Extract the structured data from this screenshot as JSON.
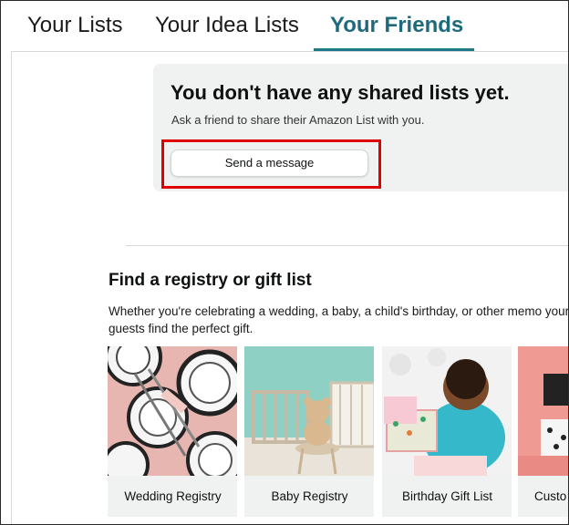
{
  "tabs": [
    {
      "label": "Your Lists"
    },
    {
      "label": "Your Idea Lists"
    },
    {
      "label": "Your Friends"
    }
  ],
  "shared": {
    "title": "You don't have any shared lists yet.",
    "subtitle": "Ask a friend to share their Amazon List with you.",
    "send_button": "Send a message"
  },
  "registry": {
    "title": "Find a registry or gift list",
    "description": "Whether you're celebrating a wedding, a baby, a child's birthday, or other memo your guests find the perfect gift.",
    "cards": [
      {
        "label": "Wedding Registry"
      },
      {
        "label": "Baby Registry"
      },
      {
        "label": "Birthday Gift List"
      },
      {
        "label": "Custo"
      }
    ]
  },
  "colors": {
    "active_tab": "#1e6a7a",
    "highlight": "#e00000",
    "panel_bg": "#f0f2f2"
  }
}
